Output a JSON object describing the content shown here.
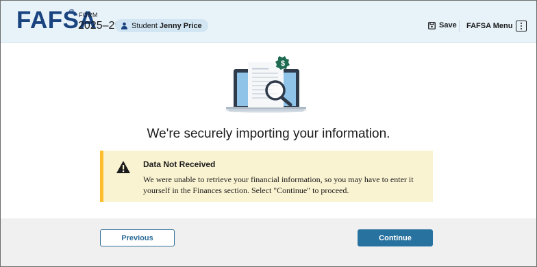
{
  "header": {
    "logo_text": "FAFSA",
    "logo_reg": "®",
    "form_label": "FORM",
    "form_year": "2025–26",
    "student_label": "Student",
    "student_name": "Jenny Price",
    "save_label": "Save",
    "menu_label": "FAFSA Menu"
  },
  "main": {
    "heading": "We're securely importing your information.",
    "illustration_icons": [
      "laptop-icon",
      "document-icon",
      "magnifier-icon",
      "dollar-badge-icon"
    ],
    "colors": {
      "brand_blue": "#1a4480",
      "header_bg": "#e7f2f9",
      "accent_green": "#1e6b52",
      "alert_bg": "#faf3d1",
      "alert_border": "#ffbe2e",
      "primary_button": "#2872a0"
    }
  },
  "alert": {
    "icon": "warning-icon",
    "title": "Data Not Received",
    "body": "We were unable to retrieve your financial information, so you may have to enter it yourself in the Finances section. Select \"Continue\" to proceed."
  },
  "footer": {
    "previous_label": "Previous",
    "continue_label": "Continue"
  }
}
